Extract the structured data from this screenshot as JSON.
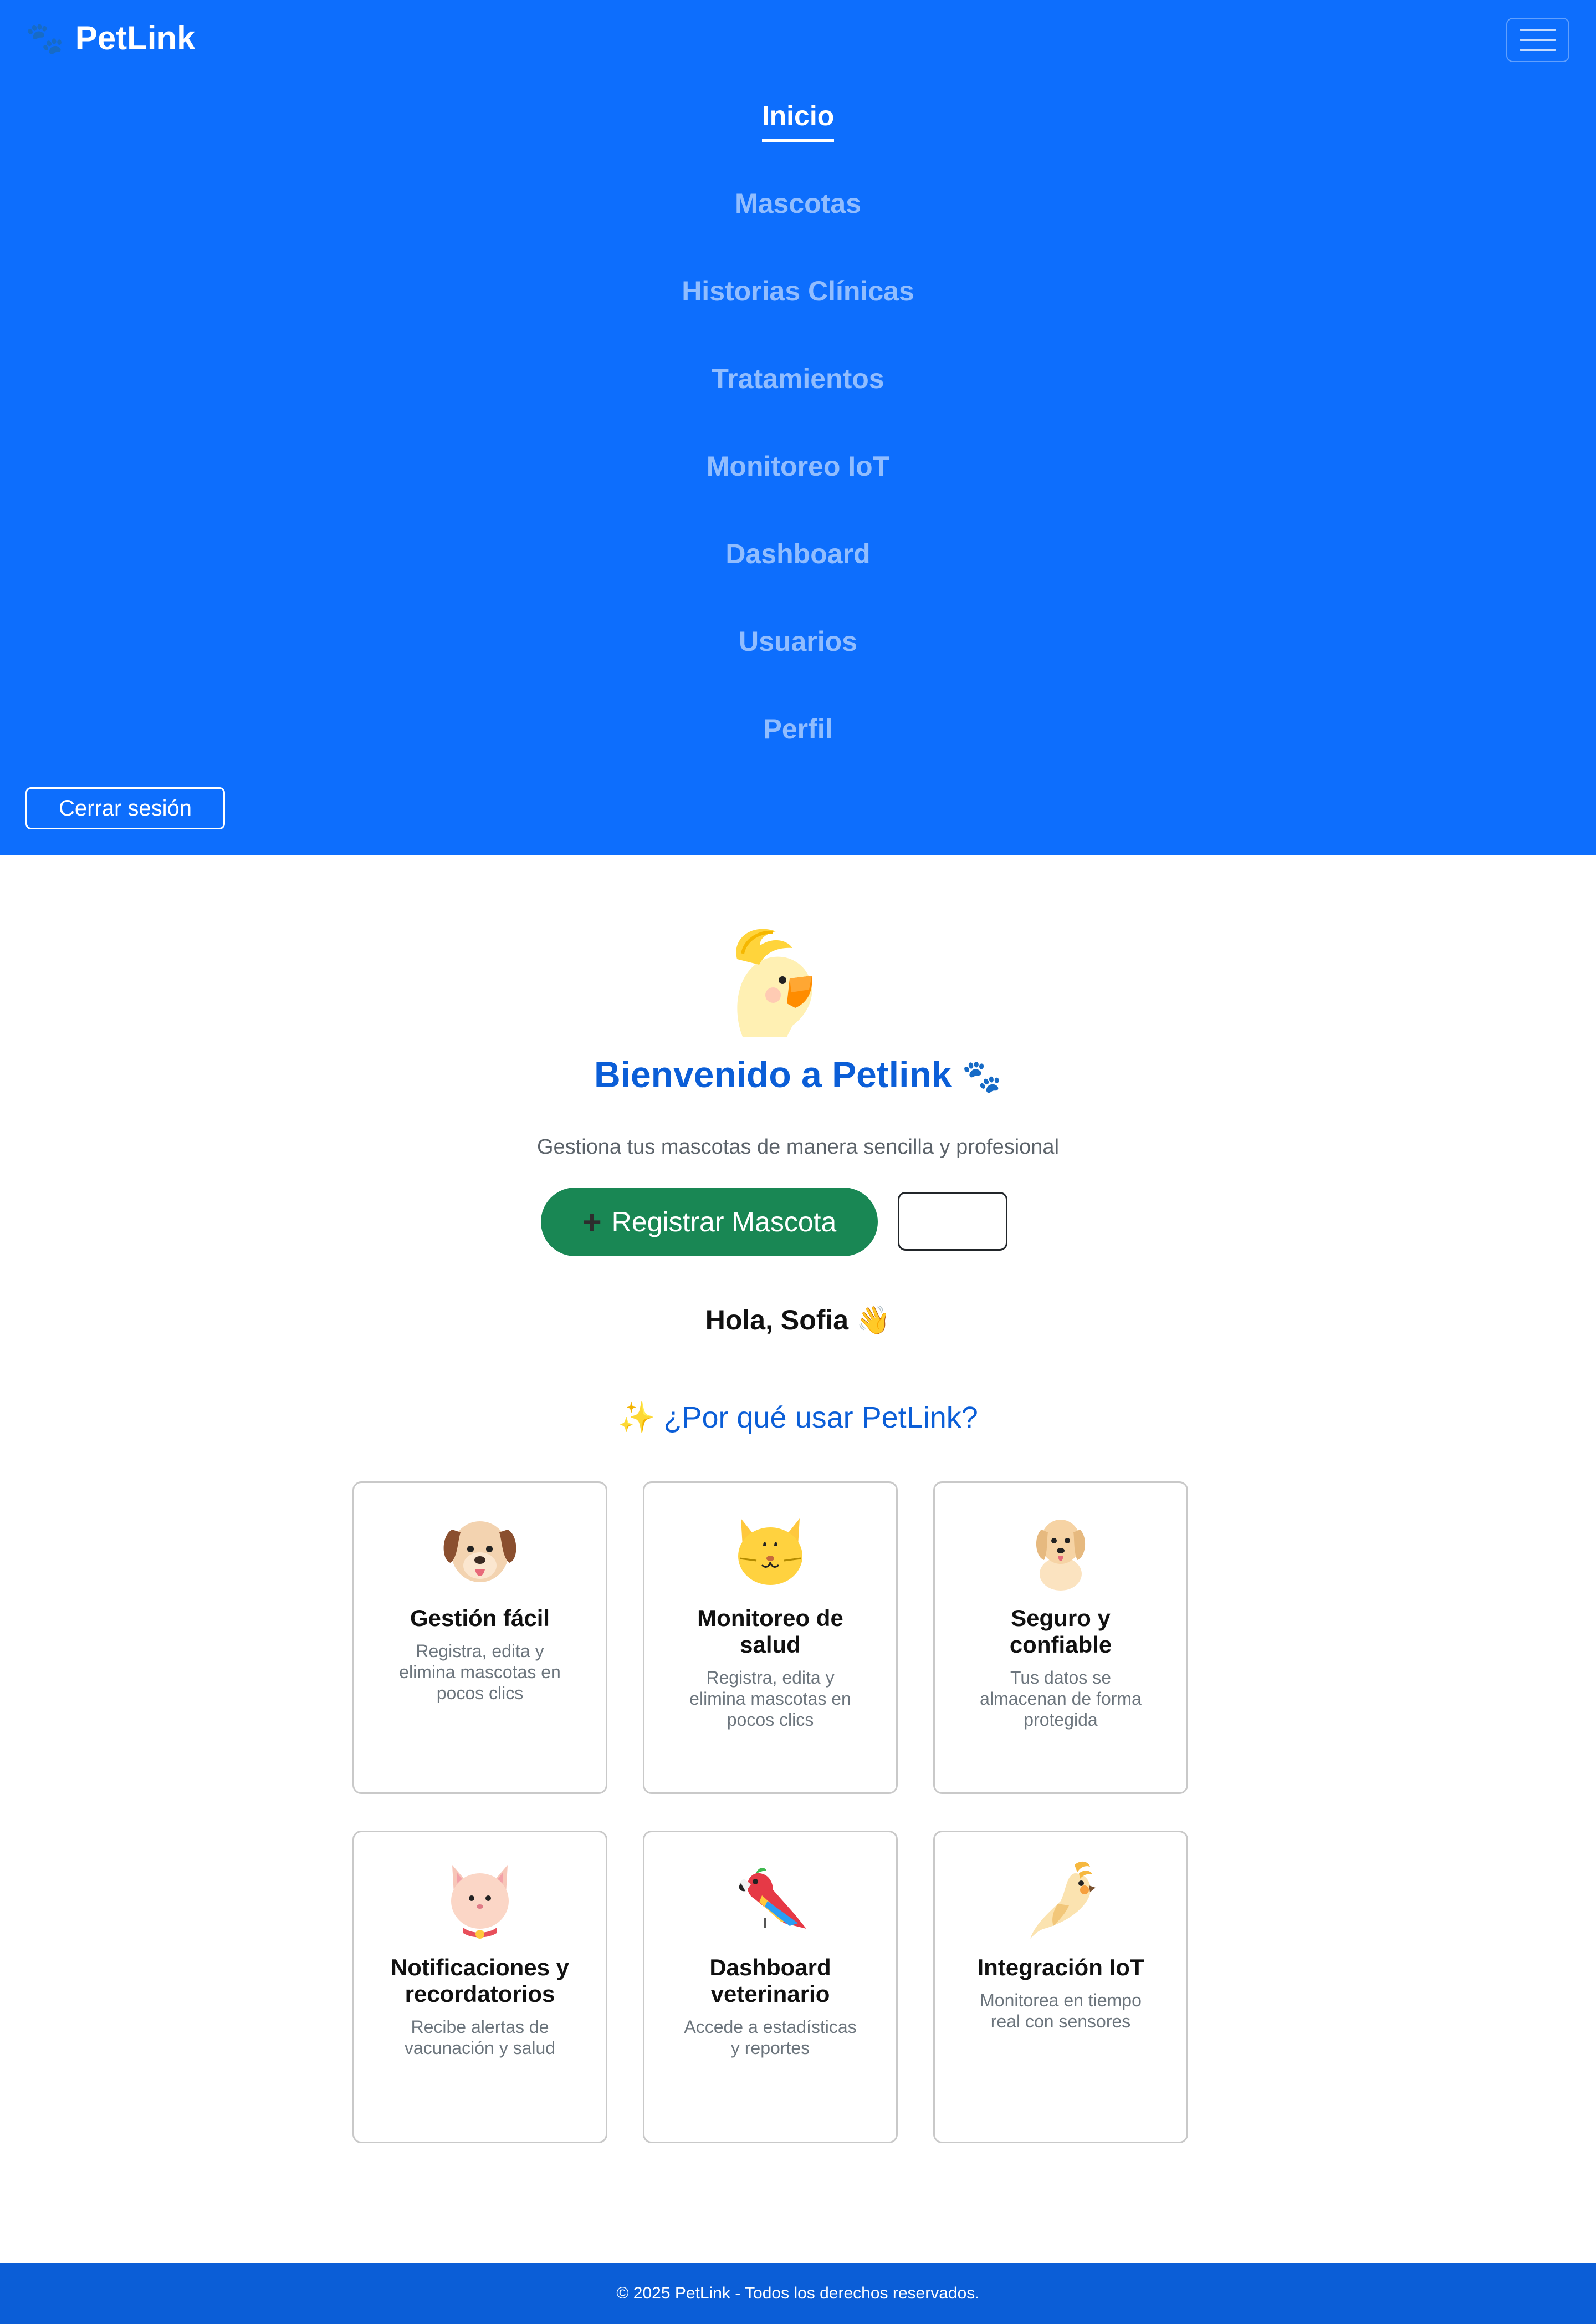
{
  "brand": {
    "name": "PetLink",
    "icon": "paw-icon"
  },
  "nav": {
    "items": [
      {
        "label": "Inicio",
        "active": true
      },
      {
        "label": "Mascotas",
        "active": false
      },
      {
        "label": "Historias Clínicas",
        "active": false
      },
      {
        "label": "Tratamientos",
        "active": false
      },
      {
        "label": "Monitoreo IoT",
        "active": false
      },
      {
        "label": "Dashboard",
        "active": false
      },
      {
        "label": "Usuarios",
        "active": false
      },
      {
        "label": "Perfil",
        "active": false
      }
    ],
    "logout_label": "Cerrar sesión"
  },
  "hero": {
    "icon": "cockatoo-icon",
    "title": "Bienvenido a Petlink",
    "title_icon": "🐾",
    "subtitle": "Gestiona tus mascotas de manera sencilla y profesional",
    "register_label": "Registrar Mascota",
    "register_icon": "➕",
    "secondary_button_label": "",
    "greeting": "Hola, Sofia 👋"
  },
  "features": {
    "title": "✨ ¿Por qué usar PetLink?",
    "cards": [
      {
        "icon": "dog-icon",
        "title": "Gestión fácil",
        "text": "Registra, edita y elimina mascotas en pocos clics"
      },
      {
        "icon": "cat-icon",
        "title": "Monitoreo de salud",
        "text": "Registra, edita y elimina mascotas en pocos clics"
      },
      {
        "icon": "golden-dog-icon",
        "title": "Seguro y confiable",
        "text": "Tus datos se almacenan de forma protegida"
      },
      {
        "icon": "pink-cat-icon",
        "title": "Notificaciones y recordatorios",
        "text": "Recibe alertas de vacunación y salud"
      },
      {
        "icon": "parrot-icon",
        "title": "Dashboard veterinario",
        "text": "Accede a estadísticas y reportes"
      },
      {
        "icon": "cockatiel-icon",
        "title": "Integración IoT",
        "text": "Monitorea en tiempo real con sensores"
      }
    ]
  },
  "footer": {
    "text": "© 2025 PetLink - Todos los derechos reservados."
  },
  "colors": {
    "nav_bg": "#0d6efd",
    "accent": "#0b5ed7",
    "success": "#198754",
    "footer_bg": "#0b5ed7"
  }
}
